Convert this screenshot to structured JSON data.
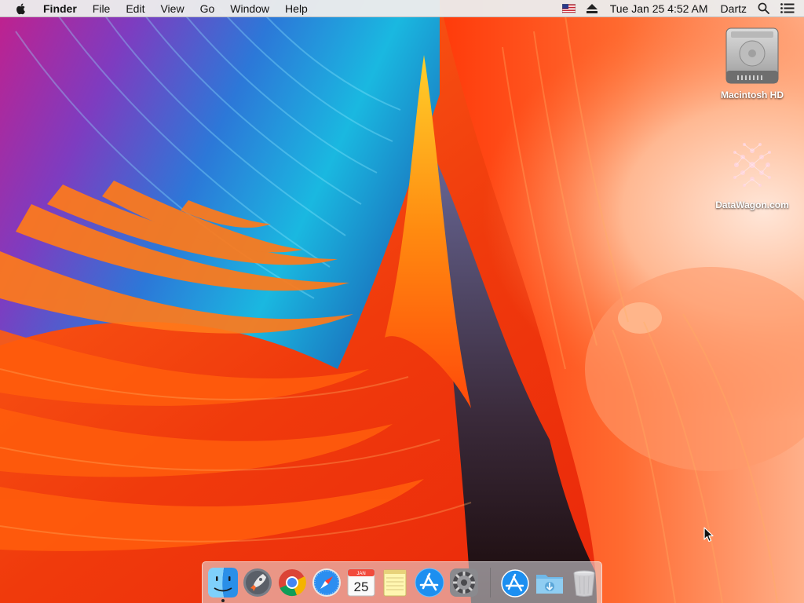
{
  "menubar": {
    "apple_icon": "apple-logo-icon",
    "app_name": "Finder",
    "menus": [
      "File",
      "Edit",
      "View",
      "Go",
      "Window",
      "Help"
    ],
    "status": {
      "input_source_icon": "us-flag-icon",
      "eject_icon": "eject-icon",
      "clock": "Tue Jan 25  4:52 AM",
      "user": "Dartz",
      "spotlight_icon": "spotlight-search-icon",
      "notification_icon": "notification-center-icon"
    }
  },
  "desktop": {
    "icons": [
      {
        "label": "Macintosh HD",
        "icon": "hard-drive-icon"
      },
      {
        "label": "DataWagon.com",
        "icon": "network-share-icon"
      }
    ]
  },
  "dock": {
    "apps": [
      {
        "name": "Finder",
        "icon": "finder-icon",
        "running": true
      },
      {
        "name": "Launchpad",
        "icon": "launchpad-icon",
        "running": false
      },
      {
        "name": "Google Chrome",
        "icon": "chrome-icon",
        "running": false
      },
      {
        "name": "Safari",
        "icon": "safari-icon",
        "running": false
      },
      {
        "name": "Calendar",
        "icon": "calendar-icon",
        "running": false,
        "month": "JAN",
        "day": "25"
      },
      {
        "name": "Notes",
        "icon": "notes-icon",
        "running": false
      },
      {
        "name": "App Store",
        "icon": "app-store-icon",
        "running": false
      },
      {
        "name": "System Preferences",
        "icon": "system-preferences-icon",
        "running": false
      }
    ],
    "others": [
      {
        "name": "Applications",
        "icon": "applications-stack-icon"
      },
      {
        "name": "Downloads",
        "icon": "downloads-folder-icon"
      },
      {
        "name": "Trash",
        "icon": "trash-icon"
      }
    ]
  },
  "colors": {
    "menubar_bg": "#ececec",
    "wallpaper_orange": "#ff5a12",
    "wallpaper_red": "#e8220a",
    "wallpaper_blue": "#1aa6d8",
    "wallpaper_purple": "#8c2fa8",
    "wallpaper_peach": "#ffc0a0"
  }
}
